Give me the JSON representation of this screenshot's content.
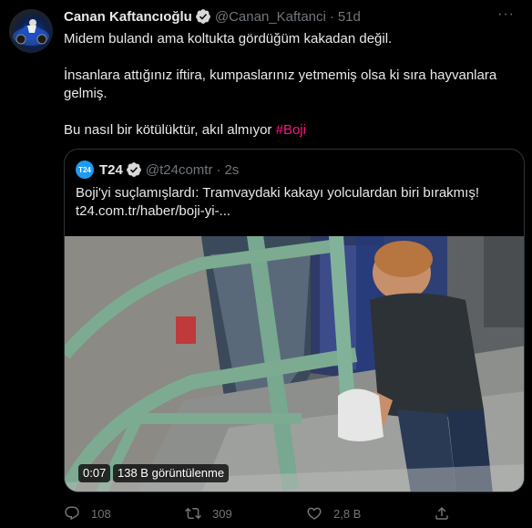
{
  "tweet": {
    "author_name": "Canan Kaftancıoğlu",
    "author_handle": "@Canan_Kaftanci",
    "separator": "·",
    "time": "51d",
    "paragraphs": [
      "Midem bulandı ama koltukta gördüğüm kakadan değil.",
      "İnsanlara attığınız iftira, kumpaslarınız yetmemiş olsa ki sıra hayvanlara gelmiş."
    ],
    "last_line": "Bu nasıl bir kötülüktür, akıl almıyor",
    "hashtag": "#Boji",
    "hashtag_color": "#f91880",
    "verified_color": "#d9d9d9"
  },
  "quoted": {
    "logo_text": "T24",
    "name": "T24",
    "handle": "@t24comtr",
    "separator": "·",
    "time": "2s",
    "text": "Boji'yi suçlamışlardı: Tramvaydaki kakayı yolculardan biri bırakmış!",
    "link": "t24.com.tr/haber/boji-yi-...",
    "video_duration": "0:07",
    "video_views": "138 B görüntülenme",
    "logo_color": "#1d9bf0"
  },
  "actions": {
    "reply_icon": "reply-icon",
    "reply_count": "108",
    "retweet_icon": "retweet-icon",
    "retweet_count": "309",
    "like_icon": "heart-icon",
    "like_count": "2,8 B",
    "share_icon": "share-icon"
  }
}
